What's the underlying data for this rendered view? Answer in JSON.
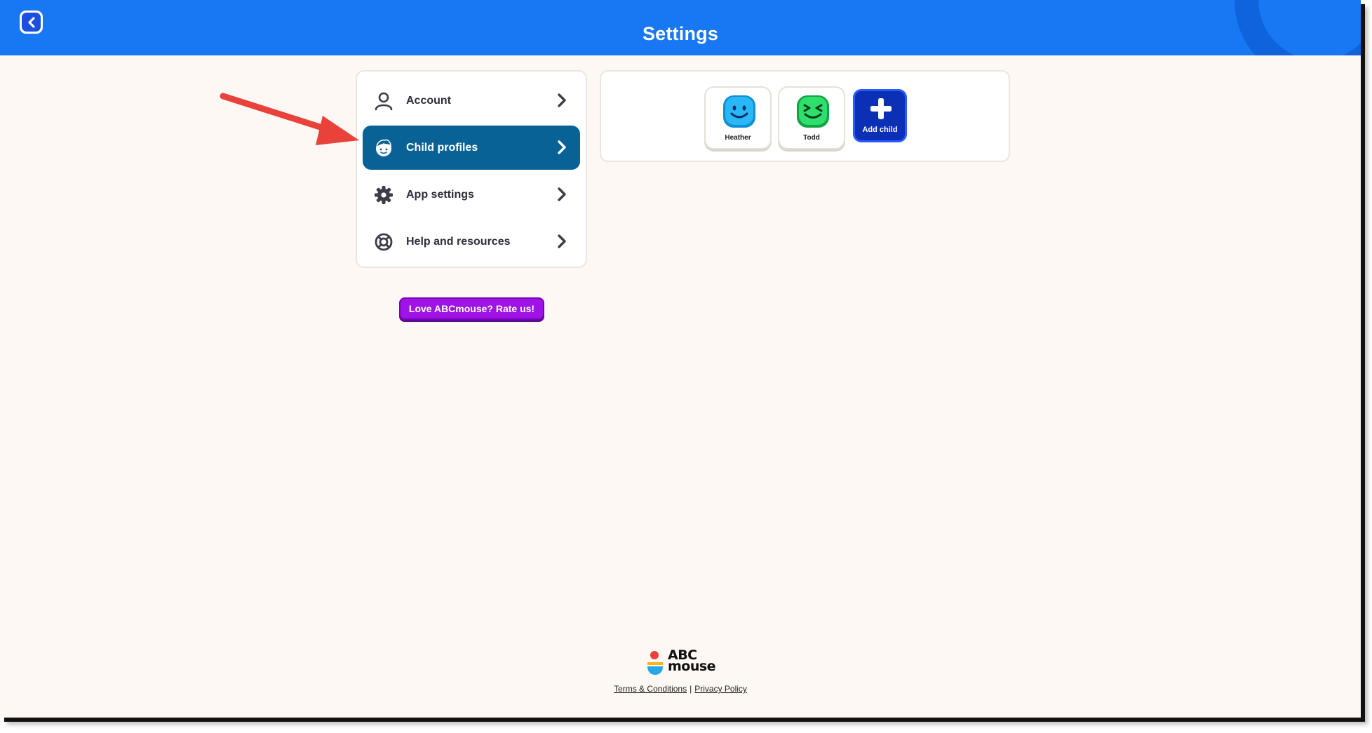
{
  "header": {
    "title": "Settings",
    "back_icon": "chevron-left-icon",
    "color": "#1877f2"
  },
  "menu": {
    "items": [
      {
        "label": "Account",
        "icon": "user-icon",
        "active": false
      },
      {
        "label": "Child profiles",
        "icon": "child-face-icon",
        "active": true
      },
      {
        "label": "App settings",
        "icon": "gear-icon",
        "active": false
      },
      {
        "label": "Help and resources",
        "icon": "lifebuoy-icon",
        "active": false
      }
    ],
    "active_color": "#086295"
  },
  "rate_button": {
    "label": "Love ABCmouse? Rate us!",
    "color": "#a013e6"
  },
  "profiles": {
    "children": [
      {
        "name": "Heather",
        "avatar": "blue-smile-face-icon",
        "color": "#1aa7f0"
      },
      {
        "name": "Todd",
        "avatar": "green-wink-face-icon",
        "color": "#1ec95a"
      }
    ],
    "add_child_label": "Add child",
    "add_child_color": "#0b2fb5"
  },
  "footer": {
    "logo_line1": "ABC",
    "logo_line2": "mouse",
    "terms_label": "Terms & Conditions",
    "separator": "|",
    "privacy_label": "Privacy Policy"
  },
  "annotation": {
    "type": "red-arrow",
    "points_to": "Child profiles",
    "color": "#e8423a"
  }
}
